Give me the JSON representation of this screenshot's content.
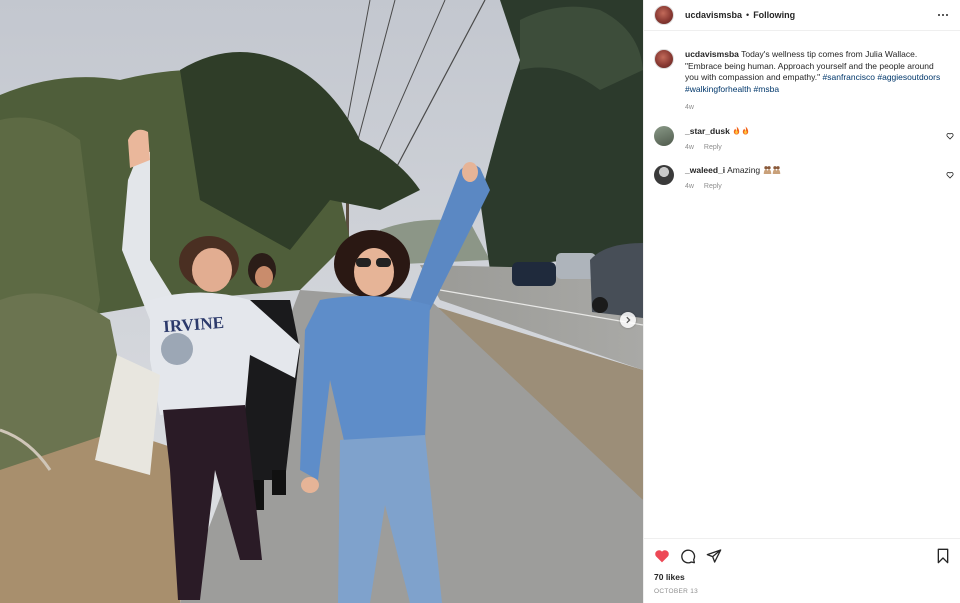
{
  "post": {
    "username": "ucdavismsba",
    "separator": "•",
    "follow_status": "Following",
    "more_icon": "more-options-icon"
  },
  "caption": {
    "username": "ucdavismsba",
    "text": "Today's wellness tip comes from Julia Wallace. \"Embrace being human. Approach yourself and the people around you with compassion and empathy.\"",
    "hashtags": [
      "#sanfrancisco",
      "#aggiesoutdoors",
      "#walkingforhealth",
      "#msba"
    ],
    "time": "4w"
  },
  "comments": [
    {
      "username": "_star_dusk",
      "text": "",
      "emoji": "fire fire",
      "time": "4w",
      "reply_label": "Reply"
    },
    {
      "username": "_waleed_i",
      "text": "Amazing",
      "emoji": "people-hugging x2",
      "time": "4w",
      "reply_label": "Reply"
    }
  ],
  "actions": {
    "liked": true,
    "like_color": "#ed4956",
    "likes": "70 likes",
    "date": "OCTOBER 13"
  },
  "photo": {
    "next_icon": "chevron-right-icon",
    "sweatshirt_text": "IRVINE"
  }
}
